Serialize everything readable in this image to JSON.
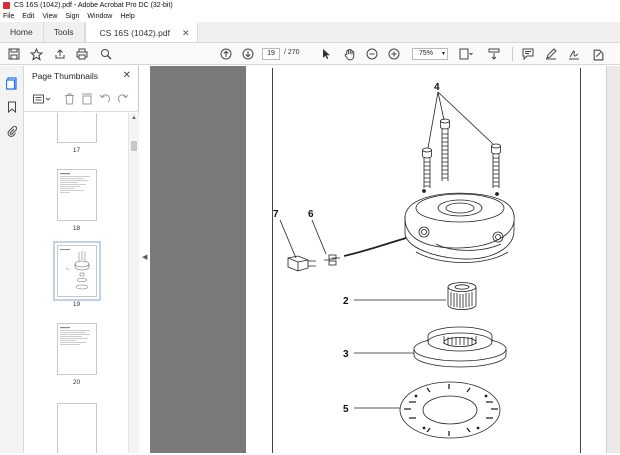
{
  "window": {
    "title": "CS 16S (1042).pdf - Adobe Acrobat Pro DC (32-bit)"
  },
  "menu": [
    "File",
    "Edit",
    "View",
    "Sign",
    "Window",
    "Help"
  ],
  "tabs": {
    "home": "Home",
    "tools": "Tools",
    "document": "CS 16S (1042).pdf",
    "close": "✕"
  },
  "toolbar": {
    "current_page": "19",
    "page_total": "/ 270",
    "zoom": "75%"
  },
  "panel": {
    "title": "Page Thumbnails",
    "close": "✕"
  },
  "thumbnails": [
    {
      "label": "17",
      "selected": false
    },
    {
      "label": "18",
      "selected": false
    },
    {
      "label": "19",
      "selected": true
    },
    {
      "label": "20",
      "selected": false
    }
  ],
  "diagram": {
    "callouts": [
      "4",
      "7",
      "6",
      "2",
      "3",
      "5"
    ]
  }
}
